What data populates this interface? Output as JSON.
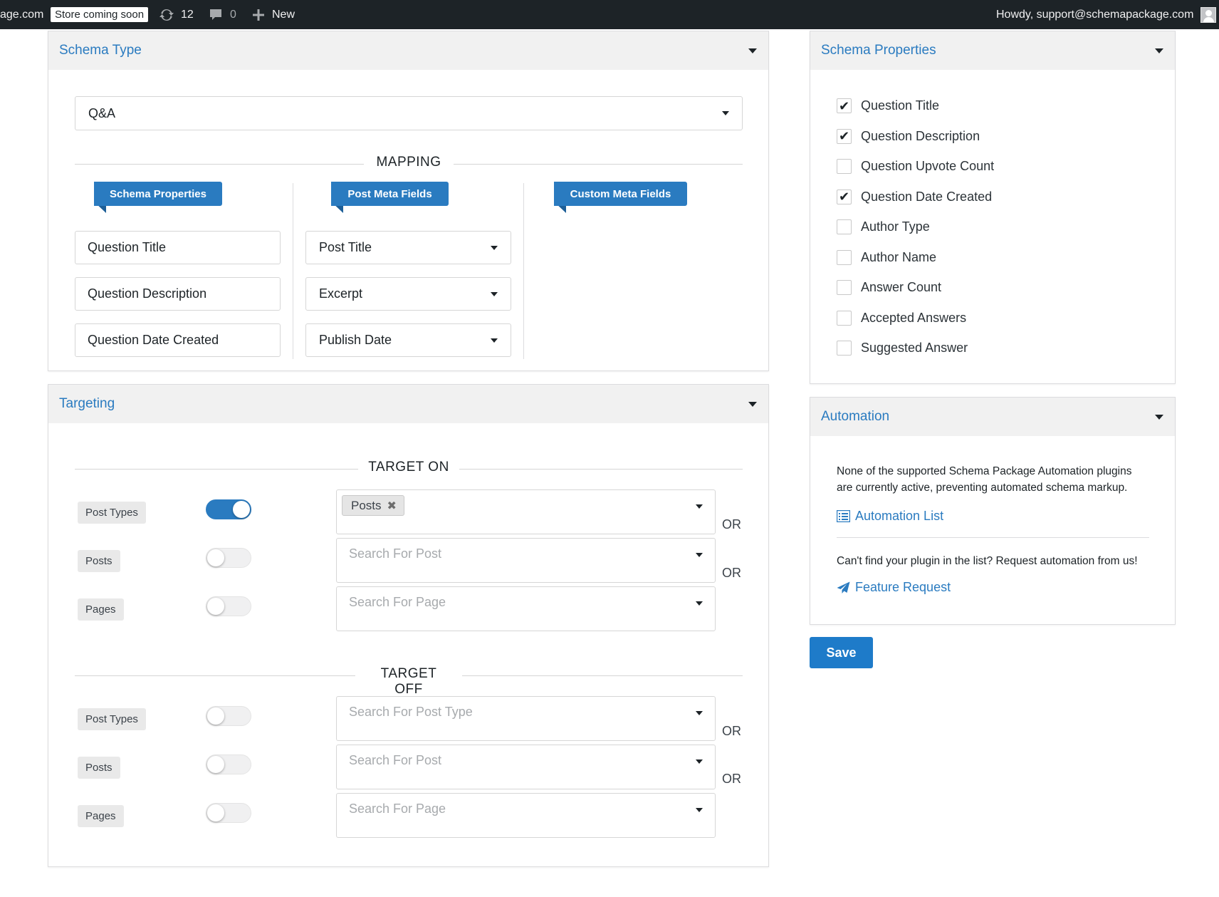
{
  "adminbar": {
    "site": "age.com",
    "store_badge": "Store coming soon",
    "updates_count": "12",
    "comments_count": "0",
    "new_label": "New",
    "howdy": "Howdy, support@schemapackage.com"
  },
  "schema_type": {
    "title": "Schema Type",
    "selected": "Q&A",
    "mapping_label": "MAPPING",
    "ribbons": [
      "Schema Properties",
      "Post Meta Fields",
      "Custom Meta Fields"
    ],
    "rows": [
      {
        "property": "Question Title",
        "meta": "Post Title"
      },
      {
        "property": "Question Description",
        "meta": "Excerpt"
      },
      {
        "property": "Question Date Created",
        "meta": "Publish Date"
      }
    ]
  },
  "targeting": {
    "title": "Targeting",
    "target_on_label": "TARGET ON",
    "target_off_label": "TARGET OFF",
    "or_label": "OR",
    "target_on": [
      {
        "label": "Post Types",
        "enabled": true,
        "chip": "Posts",
        "placeholder": ""
      },
      {
        "label": "Posts",
        "enabled": false,
        "chip": "",
        "placeholder": "Search For Post"
      },
      {
        "label": "Pages",
        "enabled": false,
        "chip": "",
        "placeholder": "Search For Page"
      }
    ],
    "target_off": [
      {
        "label": "Post Types",
        "enabled": false,
        "placeholder": "Search For Post Type"
      },
      {
        "label": "Posts",
        "enabled": false,
        "placeholder": "Search For Post"
      },
      {
        "label": "Pages",
        "enabled": false,
        "placeholder": "Search For Page"
      }
    ]
  },
  "schema_properties": {
    "title": "Schema Properties",
    "items": [
      {
        "label": "Question Title",
        "checked": true
      },
      {
        "label": "Question Description",
        "checked": true
      },
      {
        "label": "Question Upvote Count",
        "checked": false
      },
      {
        "label": "Question Date Created",
        "checked": true
      },
      {
        "label": "Author Type",
        "checked": false
      },
      {
        "label": "Author Name",
        "checked": false
      },
      {
        "label": "Answer Count",
        "checked": false
      },
      {
        "label": "Accepted Answers",
        "checked": false
      },
      {
        "label": "Suggested Answer",
        "checked": false
      }
    ]
  },
  "automation": {
    "title": "Automation",
    "notice": "None of the supported Schema Package Automation plugins are currently active, preventing automated schema markup.",
    "list_link": "Automation List",
    "request_text": "Can't find your plugin in the list? Request automation from us!",
    "feature_link": "Feature Request"
  },
  "save_label": "Save",
  "colors": {
    "accent": "#2a7bc0",
    "adminbar": "#1d2327",
    "panel_head": "#f1f1f1"
  }
}
